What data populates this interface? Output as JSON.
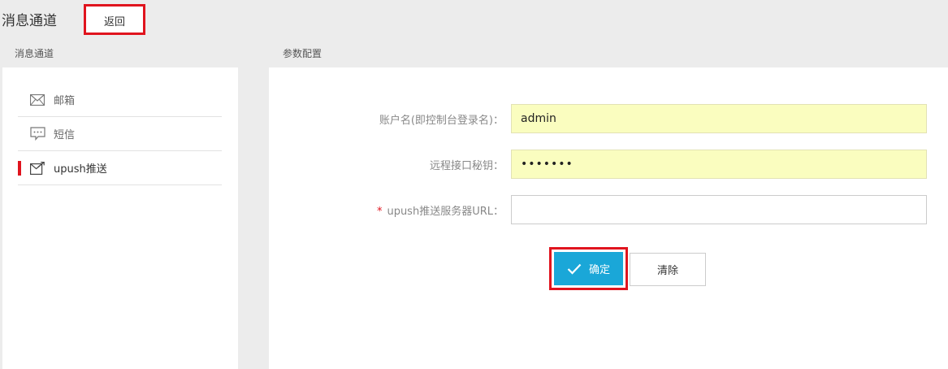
{
  "header": {
    "title": "消息通道",
    "back_label": "返回"
  },
  "left": {
    "section_title": "消息通道",
    "items": [
      {
        "label": "邮箱",
        "icon": "mail-icon"
      },
      {
        "label": "短信",
        "icon": "sms-icon"
      },
      {
        "label": "upush推送",
        "icon": "push-icon",
        "active": true
      }
    ]
  },
  "right": {
    "section_title": "参数配置",
    "fields": [
      {
        "label": "账户名(即控制台登录名)：",
        "value": "admin",
        "required": false
      },
      {
        "label": "远程接口秘钥：",
        "value": "•••••••",
        "required": false
      },
      {
        "label": "upush推送服务器URL：",
        "value": "",
        "required": true,
        "required_mark": "*"
      }
    ],
    "confirm_label": "确定",
    "clear_label": "清除"
  },
  "colors": {
    "accent": "#1aa7d8",
    "highlight": "#e0141e",
    "autofill": "#fafdbf"
  }
}
